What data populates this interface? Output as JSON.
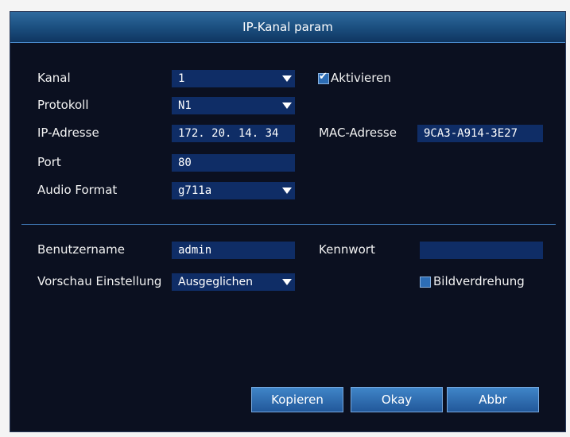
{
  "dialog": {
    "title": "IP-Kanal param"
  },
  "fields": {
    "kanal_label": "Kanal",
    "kanal_value": "1",
    "aktivieren_label": "Aktivieren",
    "aktivieren_checked": true,
    "protokoll_label": "Protokoll",
    "protokoll_value": "N1",
    "ip_label": "IP-Adresse",
    "ip_value": "172. 20. 14. 34",
    "mac_label": "MAC-Adresse",
    "mac_value": "9CA3-A914-3E27",
    "port_label": "Port",
    "port_value": "80",
    "audio_label": "Audio Format",
    "audio_value": "g711a",
    "user_label": "Benutzername",
    "user_value": "admin",
    "password_label": "Kennwort",
    "password_value": "",
    "preview_label": "Vorschau Einstellung",
    "preview_value": "Ausgeglichen",
    "rotation_label": "Bildverdrehung",
    "rotation_checked": false
  },
  "buttons": {
    "copy": "Kopieren",
    "ok": "Okay",
    "cancel": "Abbr"
  },
  "colors": {
    "background": "#0b1020",
    "title_bar": "#1a4d7d",
    "field_fill": "#0f2d66",
    "accent": "#2d6db5"
  }
}
